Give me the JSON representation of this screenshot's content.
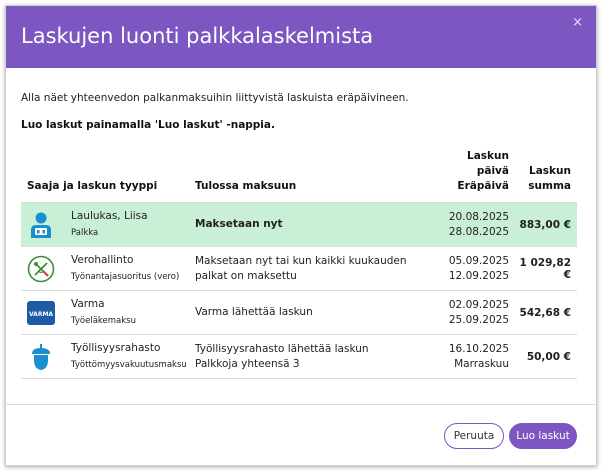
{
  "dialog": {
    "title": "Laskujen luonti palkkalaskelmista",
    "close_symbol": "×",
    "intro_text": "Alla näet yhteenvedon palkanmaksuihin liittyvistä laskuista eräpäivineen.",
    "intro_bold": "Luo laskut painamalla 'Luo laskut' -nappia."
  },
  "table": {
    "headers": {
      "payee": "Saaja ja laskun tyyppi",
      "status": "Tulossa maksuun",
      "date_line1": "Laskun",
      "date_line2": "päivä",
      "date_line3": "Eräpäivä",
      "sum_line1": "Laskun",
      "sum_line2": "summa"
    },
    "rows": [
      {
        "icon": "person-icon",
        "name": "Laulukas, Liisa",
        "type": "Palkka",
        "status_line1": "Maksetaan nyt",
        "status_line2": "",
        "date1": "20.08.2025",
        "date2": "28.08.2025",
        "sum": "883,00 €"
      },
      {
        "icon": "tax-administration-logo",
        "name": "Verohallinto",
        "type": "Työnantajasuoritus (vero)",
        "status_line1": "Maksetaan nyt tai kun kaikki kuukauden",
        "status_line2": "palkat on maksettu",
        "date1": "05.09.2025",
        "date2": "12.09.2025",
        "sum": "1 029,82 €"
      },
      {
        "icon": "varma-logo",
        "logo_text": "VARMA",
        "name": "Varma",
        "type": "Työeläkemaksu",
        "status_line1": "Varma lähettää laskun",
        "status_line2": "",
        "date1": "02.09.2025",
        "date2": "25.09.2025",
        "sum": "542,68 €"
      },
      {
        "icon": "acorn-icon",
        "name": "Työllisyysrahasto",
        "type": "Työttömyysvakuutusmaksu",
        "status_line1": "Työllisyysrahasto lähettää laskun",
        "status_line2": "Palkkoja yhteensä 3",
        "date1": "16.10.2025",
        "date2": "Marraskuu",
        "sum": "50,00 €"
      }
    ]
  },
  "buttons": {
    "cancel": "Peruuta",
    "create": "Luo laskut"
  },
  "colors": {
    "accent": "#7d57c1",
    "highlight_row": "#c9f0d7",
    "varma_blue": "#1f5aa6",
    "icon_blue": "#1a8fd0",
    "tax_green": "#3f8d3a"
  }
}
